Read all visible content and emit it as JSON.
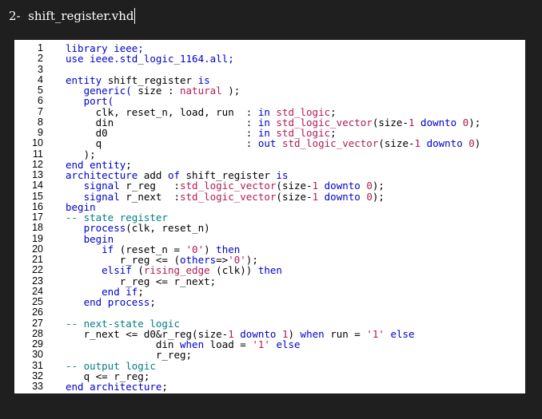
{
  "header": {
    "title": "2-  shift_register.vhd"
  },
  "colors": {
    "background": "#1f1f1f",
    "panel": "#ffffff",
    "keyword": "#0000cc",
    "type": "#b01b5a",
    "number": "#b01b5a",
    "string": "#b01b5a",
    "comment": "#007f7f",
    "plain": "#000000"
  },
  "code": {
    "lines": [
      {
        "n": "1",
        "tokens": [
          {
            "t": "library ieee;",
            "k": "kw"
          }
        ]
      },
      {
        "n": "2",
        "tokens": [
          {
            "t": "use ",
            "k": "kw"
          },
          {
            "t": "ieee.std_logic_1164.all;",
            "k": "kw"
          }
        ]
      },
      {
        "n": "3",
        "tokens": []
      },
      {
        "n": "4",
        "tokens": [
          {
            "t": "entity ",
            "k": "kw"
          },
          {
            "t": "shift_register ",
            "k": "plain"
          },
          {
            "t": "is",
            "k": "kw"
          }
        ]
      },
      {
        "n": "5",
        "tokens": [
          {
            "t": "   generic( ",
            "k": "kw"
          },
          {
            "t": "size : ",
            "k": "plain"
          },
          {
            "t": "natural",
            "k": "type"
          },
          {
            "t": " );",
            "k": "plain"
          }
        ]
      },
      {
        "n": "6",
        "tokens": [
          {
            "t": "   port(",
            "k": "kw"
          }
        ]
      },
      {
        "n": "7",
        "tokens": [
          {
            "t": "     clk, reset_n, load, run  : ",
            "k": "plain"
          },
          {
            "t": "in ",
            "k": "kw"
          },
          {
            "t": "std_logic",
            "k": "type"
          },
          {
            "t": ";",
            "k": "plain"
          }
        ]
      },
      {
        "n": "8",
        "tokens": [
          {
            "t": "     din                      : ",
            "k": "plain"
          },
          {
            "t": "in ",
            "k": "kw"
          },
          {
            "t": "std_logic_vector",
            "k": "type"
          },
          {
            "t": "(size-",
            "k": "plain"
          },
          {
            "t": "1",
            "k": "num"
          },
          {
            "t": " ",
            "k": "plain"
          },
          {
            "t": "downto",
            "k": "kw"
          },
          {
            "t": " ",
            "k": "plain"
          },
          {
            "t": "0",
            "k": "num"
          },
          {
            "t": ");",
            "k": "plain"
          }
        ]
      },
      {
        "n": "9",
        "tokens": [
          {
            "t": "     d0                       : ",
            "k": "plain"
          },
          {
            "t": "in ",
            "k": "kw"
          },
          {
            "t": "std_logic",
            "k": "type"
          },
          {
            "t": ";",
            "k": "plain"
          }
        ]
      },
      {
        "n": "10",
        "tokens": [
          {
            "t": "     q                        : ",
            "k": "plain"
          },
          {
            "t": "out ",
            "k": "kw"
          },
          {
            "t": "std_logic_vector",
            "k": "type"
          },
          {
            "t": "(size-",
            "k": "plain"
          },
          {
            "t": "1",
            "k": "num"
          },
          {
            "t": " ",
            "k": "plain"
          },
          {
            "t": "downto",
            "k": "kw"
          },
          {
            "t": " ",
            "k": "plain"
          },
          {
            "t": "0",
            "k": "num"
          },
          {
            "t": ")",
            "k": "plain"
          }
        ]
      },
      {
        "n": "11",
        "tokens": [
          {
            "t": "   );",
            "k": "plain"
          }
        ]
      },
      {
        "n": "12",
        "tokens": [
          {
            "t": "end ",
            "k": "kw"
          },
          {
            "t": "entity",
            "k": "kw"
          },
          {
            "t": ";",
            "k": "plain"
          }
        ]
      },
      {
        "n": "13",
        "tokens": [
          {
            "t": "architecture ",
            "k": "kw"
          },
          {
            "t": "add ",
            "k": "plain"
          },
          {
            "t": "of ",
            "k": "kw"
          },
          {
            "t": "shift_register ",
            "k": "plain"
          },
          {
            "t": "is",
            "k": "kw"
          }
        ]
      },
      {
        "n": "14",
        "tokens": [
          {
            "t": "   signal ",
            "k": "kw"
          },
          {
            "t": "r_reg   :",
            "k": "plain"
          },
          {
            "t": "std_logic_vector",
            "k": "type"
          },
          {
            "t": "(size-",
            "k": "plain"
          },
          {
            "t": "1",
            "k": "num"
          },
          {
            "t": " ",
            "k": "plain"
          },
          {
            "t": "downto",
            "k": "kw"
          },
          {
            "t": " ",
            "k": "plain"
          },
          {
            "t": "0",
            "k": "num"
          },
          {
            "t": ");",
            "k": "plain"
          }
        ]
      },
      {
        "n": "15",
        "tokens": [
          {
            "t": "   signal ",
            "k": "kw"
          },
          {
            "t": "r_next  :",
            "k": "plain"
          },
          {
            "t": "std_logic_vector",
            "k": "type"
          },
          {
            "t": "(size-",
            "k": "plain"
          },
          {
            "t": "1",
            "k": "num"
          },
          {
            "t": " ",
            "k": "plain"
          },
          {
            "t": "downto",
            "k": "kw"
          },
          {
            "t": " ",
            "k": "plain"
          },
          {
            "t": "0",
            "k": "num"
          },
          {
            "t": ");",
            "k": "plain"
          }
        ]
      },
      {
        "n": "16",
        "tokens": [
          {
            "t": "begin",
            "k": "kw"
          }
        ]
      },
      {
        "n": "17",
        "tokens": [
          {
            "t": "-- state register",
            "k": "comment"
          }
        ]
      },
      {
        "n": "18",
        "tokens": [
          {
            "t": "   process",
            "k": "kw"
          },
          {
            "t": "(clk, reset_n)",
            "k": "plain"
          }
        ]
      },
      {
        "n": "19",
        "tokens": [
          {
            "t": "   begin",
            "k": "kw"
          }
        ]
      },
      {
        "n": "20",
        "tokens": [
          {
            "t": "      if ",
            "k": "kw"
          },
          {
            "t": "(reset_n = ",
            "k": "plain"
          },
          {
            "t": "'0'",
            "k": "str"
          },
          {
            "t": ") ",
            "k": "plain"
          },
          {
            "t": "then",
            "k": "kw"
          }
        ]
      },
      {
        "n": "21",
        "tokens": [
          {
            "t": "         r_reg <= (",
            "k": "plain"
          },
          {
            "t": "others",
            "k": "kw"
          },
          {
            "t": "=>",
            "k": "plain"
          },
          {
            "t": "'0'",
            "k": "str"
          },
          {
            "t": ");",
            "k": "plain"
          }
        ]
      },
      {
        "n": "22",
        "tokens": [
          {
            "t": "      elsif ",
            "k": "kw"
          },
          {
            "t": "(",
            "k": "plain"
          },
          {
            "t": "rising_edge",
            "k": "type"
          },
          {
            "t": " (clk)) ",
            "k": "plain"
          },
          {
            "t": "then",
            "k": "kw"
          }
        ]
      },
      {
        "n": "23",
        "tokens": [
          {
            "t": "         r_reg <= r_next;",
            "k": "plain"
          }
        ]
      },
      {
        "n": "24",
        "tokens": [
          {
            "t": "      end ",
            "k": "kw"
          },
          {
            "t": "if",
            "k": "kw"
          },
          {
            "t": ";",
            "k": "plain"
          }
        ]
      },
      {
        "n": "25",
        "tokens": [
          {
            "t": "   end ",
            "k": "kw"
          },
          {
            "t": "process",
            "k": "kw"
          },
          {
            "t": ";",
            "k": "plain"
          }
        ]
      },
      {
        "n": "26",
        "tokens": []
      },
      {
        "n": "27",
        "tokens": [
          {
            "t": "-- next-state logic",
            "k": "comment"
          }
        ]
      },
      {
        "n": "28",
        "tokens": [
          {
            "t": "   r_next <= d0&r_reg(size-",
            "k": "plain"
          },
          {
            "t": "1",
            "k": "num"
          },
          {
            "t": " ",
            "k": "plain"
          },
          {
            "t": "downto",
            "k": "kw"
          },
          {
            "t": " ",
            "k": "plain"
          },
          {
            "t": "1",
            "k": "num"
          },
          {
            "t": ") ",
            "k": "plain"
          },
          {
            "t": "when ",
            "k": "kw"
          },
          {
            "t": "run = ",
            "k": "plain"
          },
          {
            "t": "'1'",
            "k": "str"
          },
          {
            "t": " ",
            "k": "plain"
          },
          {
            "t": "else",
            "k": "kw"
          }
        ]
      },
      {
        "n": "29",
        "tokens": [
          {
            "t": "               din ",
            "k": "plain"
          },
          {
            "t": "when ",
            "k": "kw"
          },
          {
            "t": "load = ",
            "k": "plain"
          },
          {
            "t": "'1'",
            "k": "str"
          },
          {
            "t": " ",
            "k": "plain"
          },
          {
            "t": "else",
            "k": "kw"
          }
        ]
      },
      {
        "n": "30",
        "tokens": [
          {
            "t": "               r_reg;",
            "k": "plain"
          }
        ]
      },
      {
        "n": "31",
        "tokens": [
          {
            "t": "-- output logic",
            "k": "comment"
          }
        ]
      },
      {
        "n": "32",
        "tokens": [
          {
            "t": "   q <= r_reg;",
            "k": "plain"
          }
        ]
      },
      {
        "n": "33",
        "tokens": [
          {
            "t": "end ",
            "k": "kw"
          },
          {
            "t": "architecture",
            "k": "kw"
          },
          {
            "t": ";",
            "k": "plain"
          }
        ]
      }
    ]
  }
}
